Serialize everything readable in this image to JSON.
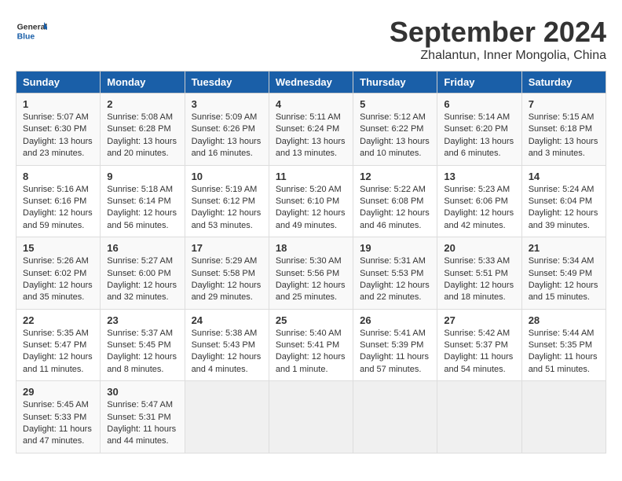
{
  "header": {
    "logo_general": "General",
    "logo_blue": "Blue",
    "title": "September 2024",
    "location": "Zhalantun, Inner Mongolia, China"
  },
  "calendar": {
    "columns": [
      "Sunday",
      "Monday",
      "Tuesday",
      "Wednesday",
      "Thursday",
      "Friday",
      "Saturday"
    ],
    "weeks": [
      [
        {
          "day": "1",
          "sunrise": "Sunrise: 5:07 AM",
          "sunset": "Sunset: 6:30 PM",
          "daylight": "Daylight: 13 hours and 23 minutes."
        },
        {
          "day": "2",
          "sunrise": "Sunrise: 5:08 AM",
          "sunset": "Sunset: 6:28 PM",
          "daylight": "Daylight: 13 hours and 20 minutes."
        },
        {
          "day": "3",
          "sunrise": "Sunrise: 5:09 AM",
          "sunset": "Sunset: 6:26 PM",
          "daylight": "Daylight: 13 hours and 16 minutes."
        },
        {
          "day": "4",
          "sunrise": "Sunrise: 5:11 AM",
          "sunset": "Sunset: 6:24 PM",
          "daylight": "Daylight: 13 hours and 13 minutes."
        },
        {
          "day": "5",
          "sunrise": "Sunrise: 5:12 AM",
          "sunset": "Sunset: 6:22 PM",
          "daylight": "Daylight: 13 hours and 10 minutes."
        },
        {
          "day": "6",
          "sunrise": "Sunrise: 5:14 AM",
          "sunset": "Sunset: 6:20 PM",
          "daylight": "Daylight: 13 hours and 6 minutes."
        },
        {
          "day": "7",
          "sunrise": "Sunrise: 5:15 AM",
          "sunset": "Sunset: 6:18 PM",
          "daylight": "Daylight: 13 hours and 3 minutes."
        }
      ],
      [
        {
          "day": "8",
          "sunrise": "Sunrise: 5:16 AM",
          "sunset": "Sunset: 6:16 PM",
          "daylight": "Daylight: 12 hours and 59 minutes."
        },
        {
          "day": "9",
          "sunrise": "Sunrise: 5:18 AM",
          "sunset": "Sunset: 6:14 PM",
          "daylight": "Daylight: 12 hours and 56 minutes."
        },
        {
          "day": "10",
          "sunrise": "Sunrise: 5:19 AM",
          "sunset": "Sunset: 6:12 PM",
          "daylight": "Daylight: 12 hours and 53 minutes."
        },
        {
          "day": "11",
          "sunrise": "Sunrise: 5:20 AM",
          "sunset": "Sunset: 6:10 PM",
          "daylight": "Daylight: 12 hours and 49 minutes."
        },
        {
          "day": "12",
          "sunrise": "Sunrise: 5:22 AM",
          "sunset": "Sunset: 6:08 PM",
          "daylight": "Daylight: 12 hours and 46 minutes."
        },
        {
          "day": "13",
          "sunrise": "Sunrise: 5:23 AM",
          "sunset": "Sunset: 6:06 PM",
          "daylight": "Daylight: 12 hours and 42 minutes."
        },
        {
          "day": "14",
          "sunrise": "Sunrise: 5:24 AM",
          "sunset": "Sunset: 6:04 PM",
          "daylight": "Daylight: 12 hours and 39 minutes."
        }
      ],
      [
        {
          "day": "15",
          "sunrise": "Sunrise: 5:26 AM",
          "sunset": "Sunset: 6:02 PM",
          "daylight": "Daylight: 12 hours and 35 minutes."
        },
        {
          "day": "16",
          "sunrise": "Sunrise: 5:27 AM",
          "sunset": "Sunset: 6:00 PM",
          "daylight": "Daylight: 12 hours and 32 minutes."
        },
        {
          "day": "17",
          "sunrise": "Sunrise: 5:29 AM",
          "sunset": "Sunset: 5:58 PM",
          "daylight": "Daylight: 12 hours and 29 minutes."
        },
        {
          "day": "18",
          "sunrise": "Sunrise: 5:30 AM",
          "sunset": "Sunset: 5:56 PM",
          "daylight": "Daylight: 12 hours and 25 minutes."
        },
        {
          "day": "19",
          "sunrise": "Sunrise: 5:31 AM",
          "sunset": "Sunset: 5:53 PM",
          "daylight": "Daylight: 12 hours and 22 minutes."
        },
        {
          "day": "20",
          "sunrise": "Sunrise: 5:33 AM",
          "sunset": "Sunset: 5:51 PM",
          "daylight": "Daylight: 12 hours and 18 minutes."
        },
        {
          "day": "21",
          "sunrise": "Sunrise: 5:34 AM",
          "sunset": "Sunset: 5:49 PM",
          "daylight": "Daylight: 12 hours and 15 minutes."
        }
      ],
      [
        {
          "day": "22",
          "sunrise": "Sunrise: 5:35 AM",
          "sunset": "Sunset: 5:47 PM",
          "daylight": "Daylight: 12 hours and 11 minutes."
        },
        {
          "day": "23",
          "sunrise": "Sunrise: 5:37 AM",
          "sunset": "Sunset: 5:45 PM",
          "daylight": "Daylight: 12 hours and 8 minutes."
        },
        {
          "day": "24",
          "sunrise": "Sunrise: 5:38 AM",
          "sunset": "Sunset: 5:43 PM",
          "daylight": "Daylight: 12 hours and 4 minutes."
        },
        {
          "day": "25",
          "sunrise": "Sunrise: 5:40 AM",
          "sunset": "Sunset: 5:41 PM",
          "daylight": "Daylight: 12 hours and 1 minute."
        },
        {
          "day": "26",
          "sunrise": "Sunrise: 5:41 AM",
          "sunset": "Sunset: 5:39 PM",
          "daylight": "Daylight: 11 hours and 57 minutes."
        },
        {
          "day": "27",
          "sunrise": "Sunrise: 5:42 AM",
          "sunset": "Sunset: 5:37 PM",
          "daylight": "Daylight: 11 hours and 54 minutes."
        },
        {
          "day": "28",
          "sunrise": "Sunrise: 5:44 AM",
          "sunset": "Sunset: 5:35 PM",
          "daylight": "Daylight: 11 hours and 51 minutes."
        }
      ],
      [
        {
          "day": "29",
          "sunrise": "Sunrise: 5:45 AM",
          "sunset": "Sunset: 5:33 PM",
          "daylight": "Daylight: 11 hours and 47 minutes."
        },
        {
          "day": "30",
          "sunrise": "Sunrise: 5:47 AM",
          "sunset": "Sunset: 5:31 PM",
          "daylight": "Daylight: 11 hours and 44 minutes."
        },
        null,
        null,
        null,
        null,
        null
      ]
    ]
  }
}
